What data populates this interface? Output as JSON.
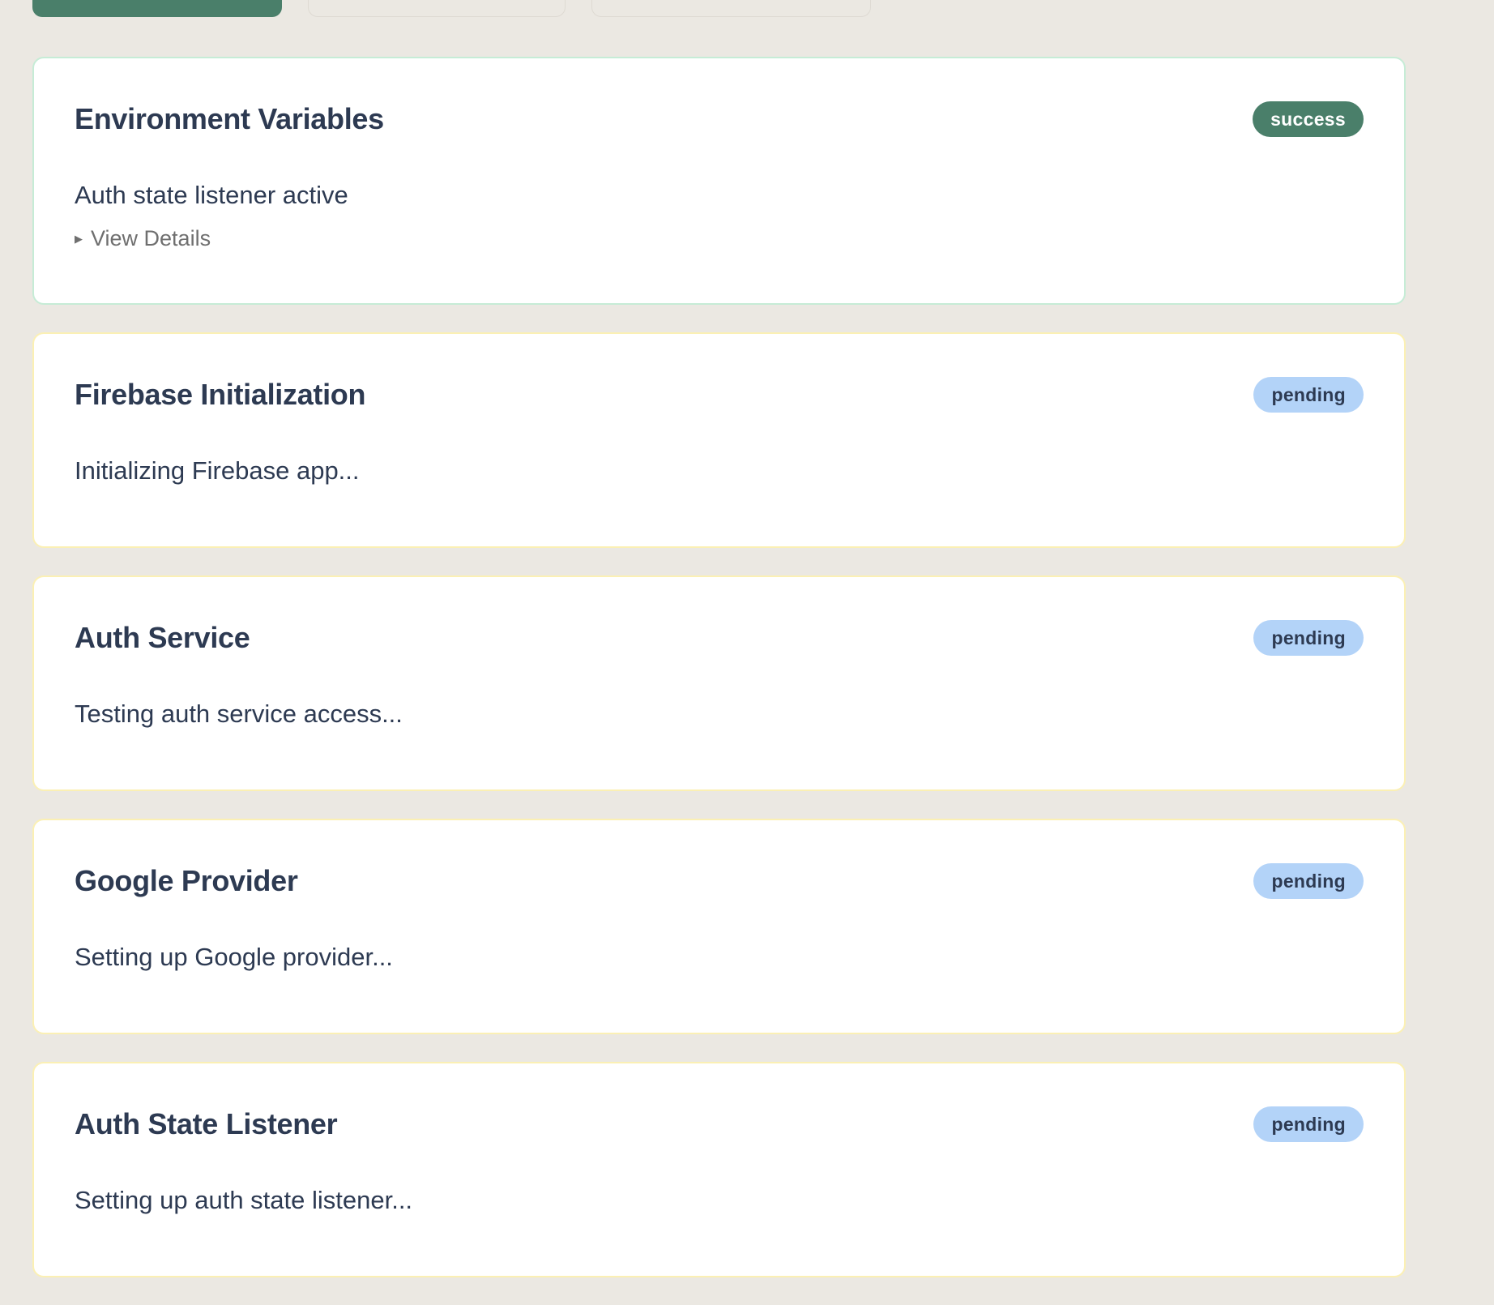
{
  "top_buttons": [
    {
      "label": ""
    },
    {
      "label": ""
    },
    {
      "label": ""
    }
  ],
  "checks": [
    {
      "title": "Environment Variables",
      "status": "success",
      "message": "Auth state listener active",
      "details_label": "View Details"
    },
    {
      "title": "Firebase Initialization",
      "status": "pending",
      "message": "Initializing Firebase app..."
    },
    {
      "title": "Auth Service",
      "status": "pending",
      "message": "Testing auth service access..."
    },
    {
      "title": "Google Provider",
      "status": "pending",
      "message": "Setting up Google provider..."
    },
    {
      "title": "Auth State Listener",
      "status": "pending",
      "message": "Setting up auth state listener..."
    }
  ],
  "details_icon": "triangle-right-icon",
  "colors": {
    "page_background": "#ebe8e2",
    "accent_green": "#4a7f6a",
    "pending_badge": "#b3d3f8",
    "success_border": "#c6ecd6",
    "pending_border": "#fbf0b4",
    "text_dark": "#2d3a52"
  }
}
